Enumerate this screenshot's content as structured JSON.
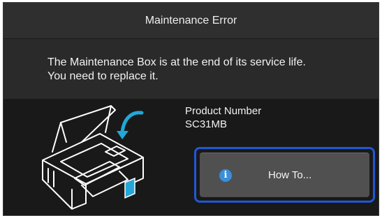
{
  "dialog": {
    "title": "Maintenance Error",
    "message_lines": [
      "The Maintenance Box is at the end of its service life.",
      "You need to replace it."
    ]
  },
  "product": {
    "label": "Product Number",
    "number": "SC31MB"
  },
  "howto_button": {
    "label": "How To...",
    "icon": "info-icon",
    "icon_glyph": "i"
  },
  "colors": {
    "focus_ring": "#1f58d6",
    "maintenance_box_highlight": "#22a7d8",
    "info_icon": "#3a8fd8"
  }
}
